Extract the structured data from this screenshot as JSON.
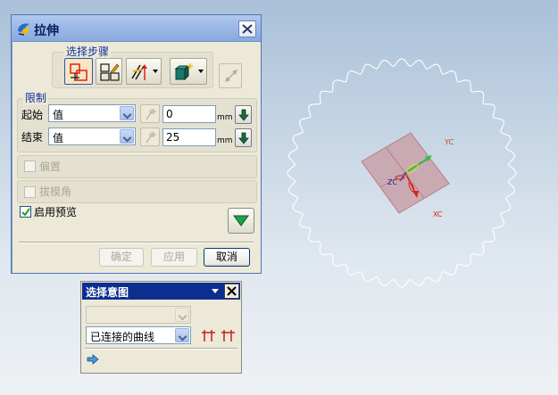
{
  "extrude_dialog": {
    "title": "拉伸",
    "selection_steps_label": "选择步骤",
    "limits_label": "限制",
    "start": {
      "label": "起始",
      "mode": "值",
      "value": "0",
      "unit": "mm"
    },
    "end": {
      "label": "结束",
      "mode": "值",
      "value": "25",
      "unit": "mm"
    },
    "offset_label": "偏置",
    "draft_label": "拔模角",
    "preview_label": "启用预览",
    "preview_checked": true,
    "ok_label": "确定",
    "apply_label": "应用",
    "cancel_label": "取消"
  },
  "selection_intent": {
    "title": "选择意图",
    "filter_value": "",
    "curve_rule": "已连接的曲线"
  },
  "viewport": {
    "axes": {
      "x": "XC",
      "y": "YC",
      "z": "ZC"
    },
    "colors": {
      "x_axis": "#d8231a",
      "y_axis": "#d8401a",
      "gear_outline": "#ffffff",
      "plane_fill": "#c8a0a8"
    }
  }
}
